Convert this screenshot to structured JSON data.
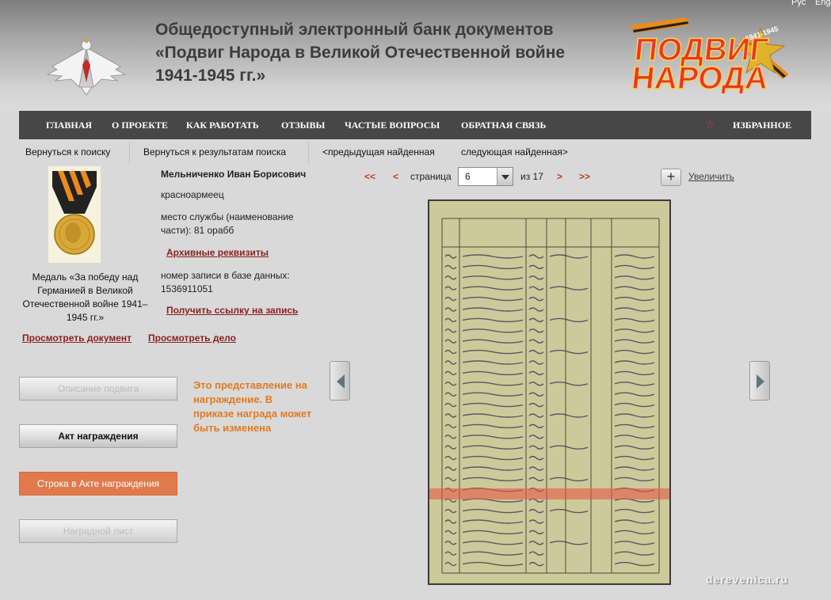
{
  "header": {
    "lang_ru": "Рус",
    "lang_en": "Eng",
    "title_line1": "Общедоступный электронный банк документов",
    "title_line2": "«Подвиг Народа в Великой Отечественной войне",
    "title_line3": "1941-1945 гг.»",
    "logo_year": "1941-1945",
    "logo_word1": "ПОДВИГ",
    "logo_word2": "НАРОДА"
  },
  "nav": {
    "items": [
      "ГЛАВНАЯ",
      "О ПРОЕКТЕ",
      "КАК РАБОТАТЬ",
      "ОТЗЫВЫ",
      "ЧАСТЫЕ ВОПРОСЫ",
      "ОБРАТНАЯ СВЯЗЬ"
    ],
    "favorites": "ИЗБРАННОЕ"
  },
  "subnav": {
    "back_search": "Вернуться к поиску",
    "back_results": "Вернуться к результатам поиска",
    "prev_found": "<предыдущая найденная",
    "next_found": "следующая найденная>"
  },
  "award": {
    "caption": "Медаль «За победу над Германией в Великой Отечественной войне 1941–1945 гг.»",
    "view_document": "Просмотреть документ",
    "view_case": "Просмотреть дело"
  },
  "person": {
    "name": "Мельниченко Иван Борисович",
    "rank": "красноармеец",
    "service_label": "место службы (наименование части):",
    "service_value": "81 орабб",
    "archive_link": "Архивные реквизиты",
    "record_label": "номер записи в базе данных:",
    "record_value": "1536911051",
    "get_link": "Получить ссылку на запись"
  },
  "pager": {
    "first": "<<",
    "prev": "<",
    "label": "страница",
    "current": "6",
    "of_label": "из 17",
    "next": ">",
    "last": ">>",
    "zoom_symbol": "+",
    "zoom_label": "Увеличить"
  },
  "buttons": {
    "feat_description": "Описание подвига",
    "award_act": "Акт награждения",
    "act_row": "Строка в Акте награждения",
    "award_sheet": "Наградной лист"
  },
  "note": "Это представление на награждение. В приказе награда может быть изменена",
  "watermark": "derevenica.ru",
  "colors": {
    "nav_bg": "#474747",
    "link_red": "#8a1f1f",
    "selected_button": "#e07a4c",
    "note_orange": "#e07a22",
    "highlight_row": "#e85846"
  }
}
